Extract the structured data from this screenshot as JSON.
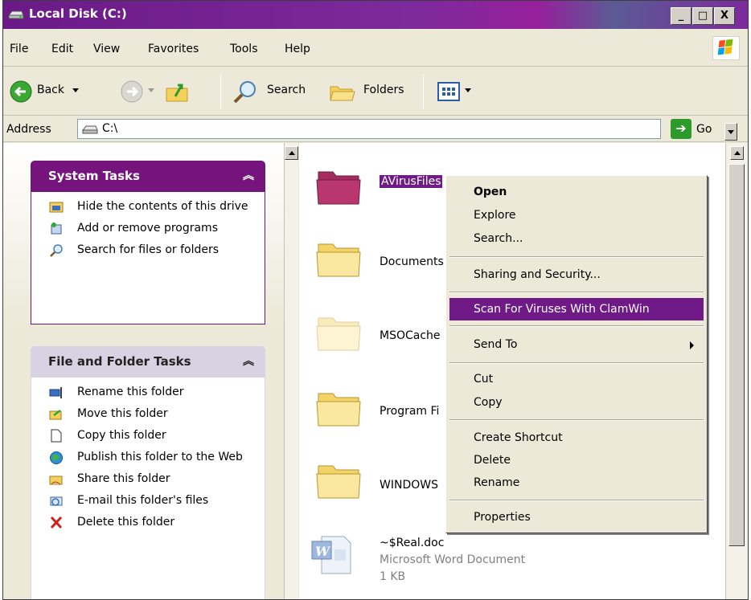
{
  "window": {
    "title": "Local Disk (C:)",
    "caption_buttons": [
      "_",
      "□",
      "X"
    ]
  },
  "menubar": {
    "items": [
      "File",
      "Edit",
      "View",
      "Favorites",
      "Tools",
      "Help"
    ]
  },
  "toolbar": {
    "back_label": "Back",
    "search_label": "Search",
    "folders_label": "Folders"
  },
  "address": {
    "label": "Address",
    "value": "C:\\",
    "go_label": "Go"
  },
  "system_tasks": {
    "title": "System Tasks",
    "items": [
      {
        "label": "Hide the contents of this drive",
        "icon": "hide-contents-icon"
      },
      {
        "label": "Add or remove programs",
        "icon": "add-remove-programs-icon"
      },
      {
        "label": "Search for files or folders",
        "icon": "search-icon"
      }
    ]
  },
  "file_tasks": {
    "title": "File and Folder Tasks",
    "items": [
      {
        "label": "Rename this folder",
        "icon": "rename-icon"
      },
      {
        "label": "Move this folder",
        "icon": "move-icon"
      },
      {
        "label": "Copy this folder",
        "icon": "copy-icon"
      },
      {
        "label": "Publish this folder to the Web",
        "icon": "publish-web-icon"
      },
      {
        "label": "Share this folder",
        "icon": "share-folder-icon"
      },
      {
        "label": "E-mail this folder's files",
        "icon": "email-icon"
      },
      {
        "label": "Delete this folder",
        "icon": "delete-icon"
      }
    ]
  },
  "files": [
    {
      "name": "AVirusFiles",
      "type": "folder",
      "selected": true
    },
    {
      "name": "Documents",
      "type": "folder"
    },
    {
      "name": "MSOCache",
      "type": "folder",
      "hidden": true
    },
    {
      "name": "Program Fi",
      "type": "folder"
    },
    {
      "name": "WINDOWS",
      "type": "folder"
    },
    {
      "name": "~$Real.doc",
      "type": "word-document",
      "detail": "Microsoft Word Document",
      "size": "1 KB"
    }
  ],
  "context_menu": {
    "items": [
      {
        "label": "Open",
        "bold": true
      },
      {
        "label": "Explore"
      },
      {
        "label": "Search..."
      },
      {
        "label": "Sharing and Security..."
      },
      {
        "label": "Scan For Viruses With ClamWin",
        "highlighted": true
      },
      {
        "label": "Send To",
        "submenu": true
      },
      {
        "label": "Cut"
      },
      {
        "label": "Copy"
      },
      {
        "label": "Create Shortcut"
      },
      {
        "label": "Delete"
      },
      {
        "label": "Rename"
      },
      {
        "label": "Properties"
      }
    ]
  },
  "colors": {
    "title_bar": "#7d2a9c",
    "task_header_system": "#76147e",
    "selection": "#6f1a86",
    "selected_folder": "#b9366f"
  }
}
